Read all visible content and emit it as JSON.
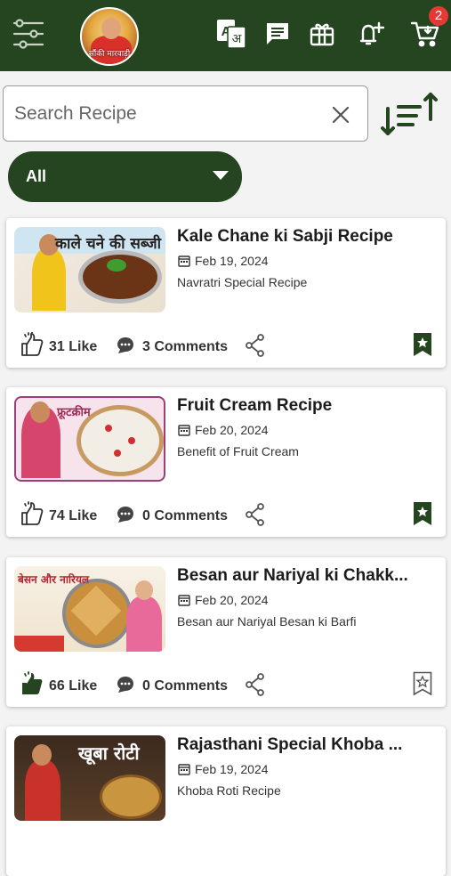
{
  "header": {
    "logo_text": "सौंकी मारवाड़ी",
    "cart_count": "2",
    "icons": [
      "menu-icon",
      "translate-icon",
      "chat-icon",
      "gift-icon",
      "add-notification-icon",
      "cart-icon"
    ]
  },
  "search": {
    "placeholder": "Search Recipe",
    "value": ""
  },
  "filter": {
    "selected": "All"
  },
  "colors": {
    "primary": "#24451f",
    "badge": "#e53935"
  },
  "recipes": [
    {
      "title": "Kale Chane ki Sabji Recipe",
      "date": "Feb 19, 2024",
      "description": "Navratri Special Recipe",
      "likes": "31 Like",
      "comments": "3 Comments",
      "thumb_text": "काले चने की सब्जी",
      "liked": false,
      "bookmarked": true
    },
    {
      "title": "Fruit Cream Recipe",
      "date": "Feb 20, 2024",
      "description": "Benefit of Fruit Cream",
      "likes": "74 Like",
      "comments": "0 Comments",
      "thumb_text": "फ्रूटक्रीम",
      "liked": false,
      "bookmarked": true
    },
    {
      "title": "Besan aur Nariyal ki Chakk...",
      "date": "Feb 20, 2024",
      "description": "Besan aur Nariyal Besan ki Barfi",
      "likes": "66 Like",
      "comments": "0 Comments",
      "thumb_text": "बेसन और नारियल",
      "liked": true,
      "bookmarked": false
    },
    {
      "title": "Rajasthani Special Khoba ...",
      "date": "Feb 19, 2024",
      "description": "Khoba Roti Recipe",
      "likes": "",
      "comments": "",
      "thumb_text": "खूबा रोटी",
      "liked": false,
      "bookmarked": false
    }
  ]
}
